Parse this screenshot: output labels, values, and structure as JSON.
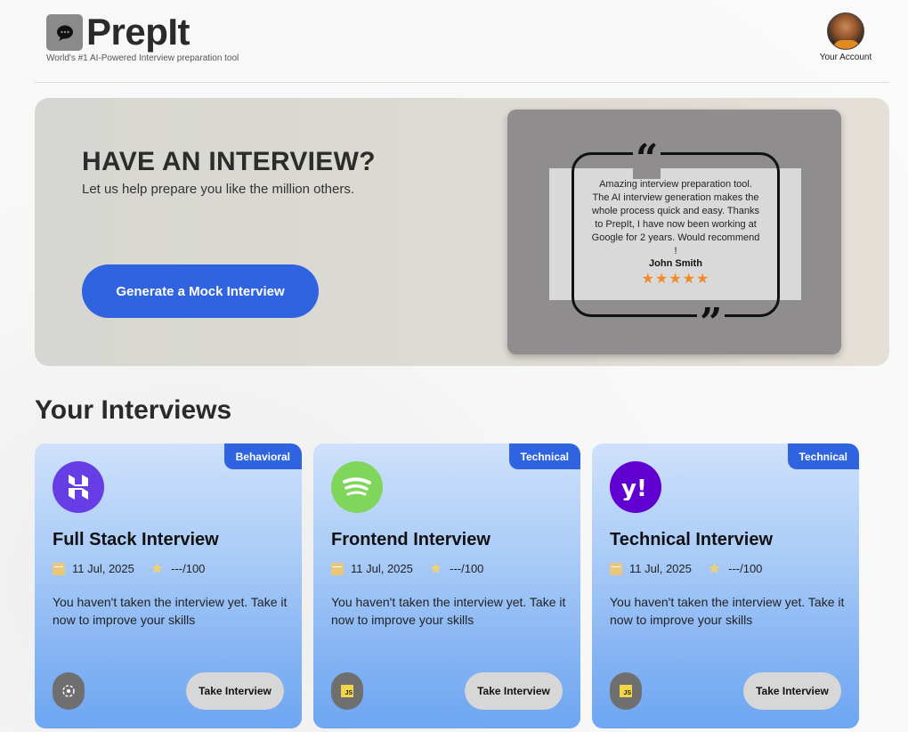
{
  "header": {
    "brand": "PrepIt",
    "tagline": "World's #1 AI-Powered Interview preparation tool",
    "account_label": "Your Account"
  },
  "hero": {
    "title": "HAVE AN INTERVIEW?",
    "subtitle": "Let us help prepare you like the million others.",
    "cta_label": "Generate a Mock Interview",
    "testimonial": {
      "quote_open": "“",
      "quote_close": "”",
      "text": "Amazing interview preparation tool. The AI interview generation makes the whole process quick and easy. Thanks to PrepIt, I have now been working at Google for 2 years. Would recommend !",
      "author": "John Smith",
      "stars": "★★★★★",
      "rating": 5
    }
  },
  "section_title": "Your Interviews",
  "cards": [
    {
      "badge": "Behavioral",
      "title": "Full Stack Interview",
      "date": "11 Jul, 2025",
      "score": "---/100",
      "description": "You haven't taken the interview yet. Take it now to improve your skills",
      "button": "Take Interview",
      "logo_icon": "hostinger-icon",
      "logo_color": "#673de6",
      "tech_icon": "tech-stack-icon"
    },
    {
      "badge": "Technical",
      "title": "Frontend Interview",
      "date": "11 Jul, 2025",
      "score": "---/100",
      "description": "You haven't taken the interview yet. Take it now to improve your skills",
      "button": "Take Interview",
      "logo_icon": "spotify-icon",
      "logo_color": "#7fd65b",
      "tech_icon": "javascript-icon"
    },
    {
      "badge": "Technical",
      "title": "Technical Interview",
      "date": "11 Jul, 2025",
      "score": "---/100",
      "description": "You haven't taken the interview yet. Take it now to improve your skills",
      "button": "Take Interview",
      "logo_icon": "yahoo-icon",
      "logo_color": "#6001d2",
      "tech_icon": "javascript-icon"
    }
  ],
  "colors": {
    "accent": "#2f63e0",
    "star": "#f08a2a"
  }
}
